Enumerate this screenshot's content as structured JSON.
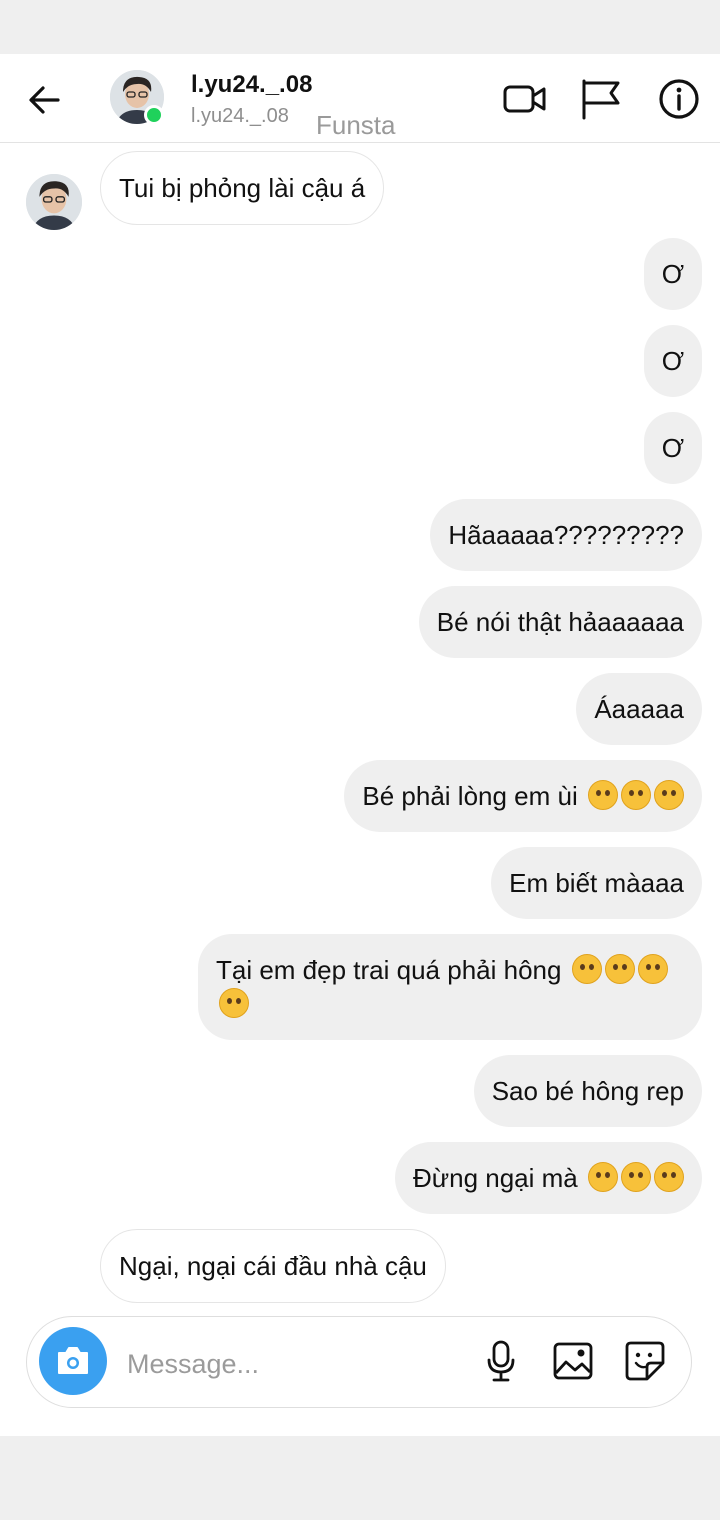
{
  "header": {
    "display_name": "l.yu24._.08",
    "username": "l.yu24._.08",
    "tag": "Funsta",
    "back_icon": "back-arrow-icon",
    "video_icon": "video-camera-icon",
    "flag_icon": "flag-icon",
    "info_icon": "info-icon"
  },
  "messages": [
    {
      "side": "in",
      "text": "Tui bị phỏng lài cậu á"
    },
    {
      "side": "out",
      "text": "Ơ"
    },
    {
      "side": "out",
      "text": "Ơ"
    },
    {
      "side": "out",
      "text": "Ơ"
    },
    {
      "side": "out",
      "text": "Hãaaaaa?????????"
    },
    {
      "side": "out",
      "text": "Bé nói thật hảaaaaaa"
    },
    {
      "side": "out",
      "text": "Áaaaaa"
    },
    {
      "side": "out",
      "text": "Bé phải lòng em ùi",
      "emoji": "pleading-face",
      "emoji_count": 3
    },
    {
      "side": "out",
      "text": "Em biết màaaa"
    },
    {
      "side": "out",
      "text": "Tại em đẹp trai quá phải hông",
      "emoji": "kissing-face",
      "emoji_count": 4
    },
    {
      "side": "out",
      "text": "Sao bé hông rep"
    },
    {
      "side": "out",
      "text": "Đừng ngại mà",
      "emoji": "kissing-closed-eyes-face",
      "emoji_count": 3
    },
    {
      "side": "in",
      "text": "Ngại, ngại cái đầu nhà cậu"
    }
  ],
  "composer": {
    "placeholder": "Message...",
    "camera_icon": "camera-icon",
    "mic_icon": "microphone-icon",
    "gallery_icon": "image-icon",
    "sticker_icon": "sticker-icon"
  },
  "colors": {
    "online": "#1fd15b",
    "camera_button": "#3aa0f0",
    "bubble_out": "#efefef"
  }
}
